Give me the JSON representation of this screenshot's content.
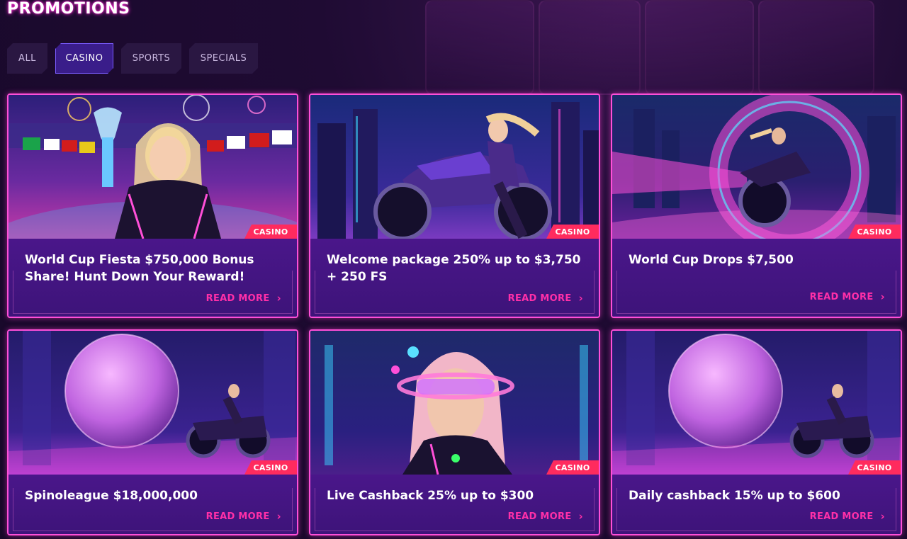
{
  "page": {
    "title": "PROMOTIONS"
  },
  "tabs": [
    {
      "label": "ALL",
      "active": false
    },
    {
      "label": "CASINO",
      "active": true
    },
    {
      "label": "SPORTS",
      "active": false
    },
    {
      "label": "SPECIALS",
      "active": false
    }
  ],
  "cards": [
    {
      "title": "World Cup Fiesta $750,000 Bonus Share! Hunt Down Your Reward!",
      "badge": "CASINO",
      "cta": "READ MORE",
      "image": "trophy-woman-stadium"
    },
    {
      "title": "Welcome package 250% up to $3,750 + 250 FS",
      "badge": "CASINO",
      "cta": "READ MORE",
      "image": "woman-motorcycle-city"
    },
    {
      "title": "World Cup Drops $7,500",
      "badge": "CASINO",
      "cta": "READ MORE",
      "image": "motorcycle-neon-loop"
    },
    {
      "title": "Spinoleague $18,000,000",
      "badge": "CASINO",
      "cta": "READ MORE",
      "image": "disco-sphere-motorcycle"
    },
    {
      "title": "Live Cashback 25% up to $300",
      "badge": "CASINO",
      "cta": "READ MORE",
      "image": "woman-visor-neon"
    },
    {
      "title": "Daily cashback 15% up to $600",
      "badge": "CASINO",
      "cta": "READ MORE",
      "image": "disco-sphere-motorcycle"
    }
  ],
  "colors": {
    "accent": "#ff2fa8",
    "badge": "#ff2b5e",
    "card_border": "#ff4fd8",
    "tab_active": "#3a1d8a"
  }
}
